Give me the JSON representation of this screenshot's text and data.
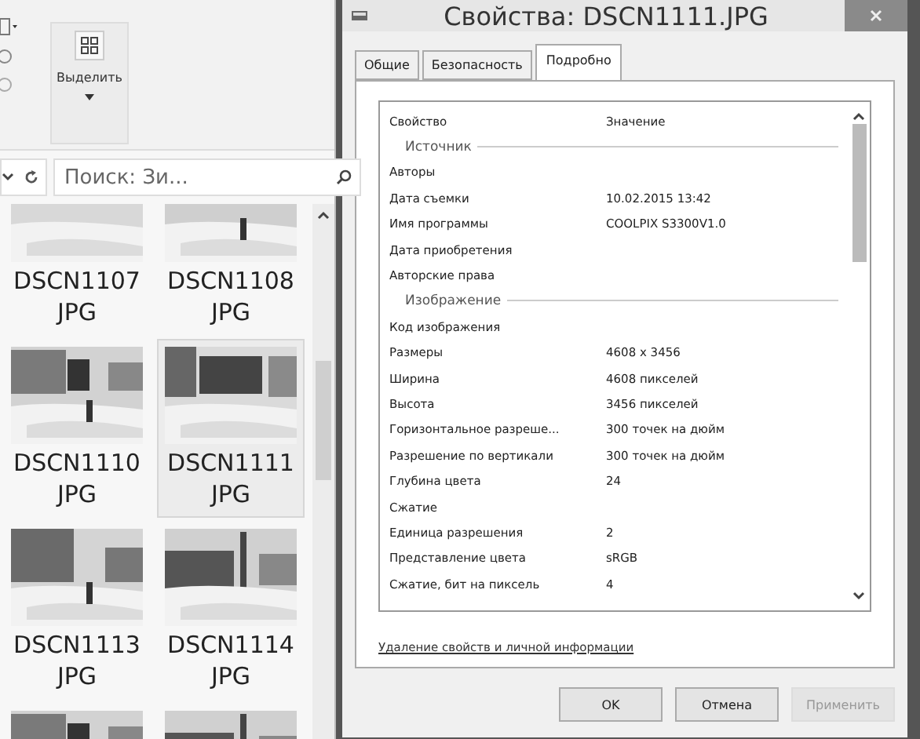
{
  "explorer": {
    "ribbon": {
      "select_button": "Выделить"
    },
    "search": {
      "placeholder": "Поиск: Зи..."
    },
    "files": [
      {
        "name": "DSCN1107",
        "ext": "JPG",
        "selected": false
      },
      {
        "name": "DSCN1108",
        "ext": "JPG",
        "selected": false
      },
      {
        "name": "DSCN1110",
        "ext": "JPG",
        "selected": false
      },
      {
        "name": "DSCN1111",
        "ext": "JPG",
        "selected": true
      },
      {
        "name": "DSCN1113",
        "ext": "JPG",
        "selected": false
      },
      {
        "name": "DSCN1114",
        "ext": "JPG",
        "selected": false
      }
    ]
  },
  "dialog": {
    "title": "Свойства: DSCN1111.JPG",
    "tabs": [
      {
        "label": "Общие",
        "selected": false
      },
      {
        "label": "Безопасность",
        "selected": false
      },
      {
        "label": "Подробно",
        "selected": true
      }
    ],
    "columns": [
      "Свойство",
      "Значение"
    ],
    "properties": [
      {
        "kind": "group",
        "label": "Источник"
      },
      {
        "kind": "row",
        "name": "Авторы"
      },
      {
        "kind": "row",
        "name": "Дата съемки",
        "value": "10.02.2015 13:42"
      },
      {
        "kind": "row",
        "name": "Имя программы",
        "value": "COOLPIX S3300V1.0"
      },
      {
        "kind": "row",
        "name": "Дата приобретения"
      },
      {
        "kind": "row",
        "name": "Авторские права"
      },
      {
        "kind": "group",
        "label": "Изображение"
      },
      {
        "kind": "row",
        "name": "Код изображения"
      },
      {
        "kind": "row",
        "name": "Размеры",
        "value": "4608 x 3456"
      },
      {
        "kind": "row",
        "name": "Ширина",
        "value": "4608 пикселей"
      },
      {
        "kind": "row",
        "name": "Высота",
        "value": "3456 пикселей"
      },
      {
        "kind": "row",
        "name": "Горизонтальное разреше...",
        "value": "300 точек на дюйм"
      },
      {
        "kind": "row",
        "name": "Разрешение по вертикали",
        "value": "300 точек на дюйм"
      },
      {
        "kind": "row",
        "name": "Глубина цвета",
        "value": "24"
      },
      {
        "kind": "row",
        "name": "Сжатие"
      },
      {
        "kind": "row",
        "name": "Единица разрешения",
        "value": "2"
      },
      {
        "kind": "row",
        "name": "Представление цвета",
        "value": "sRGB"
      },
      {
        "kind": "row",
        "name": "Сжатие, бит на пиксель",
        "value": "4"
      }
    ],
    "link": "Удаление свойств и личной информации",
    "buttons": [
      {
        "label": "OK",
        "disabled": false
      },
      {
        "label": "Отмена",
        "disabled": false
      },
      {
        "label": "Применить",
        "disabled": true
      }
    ]
  }
}
